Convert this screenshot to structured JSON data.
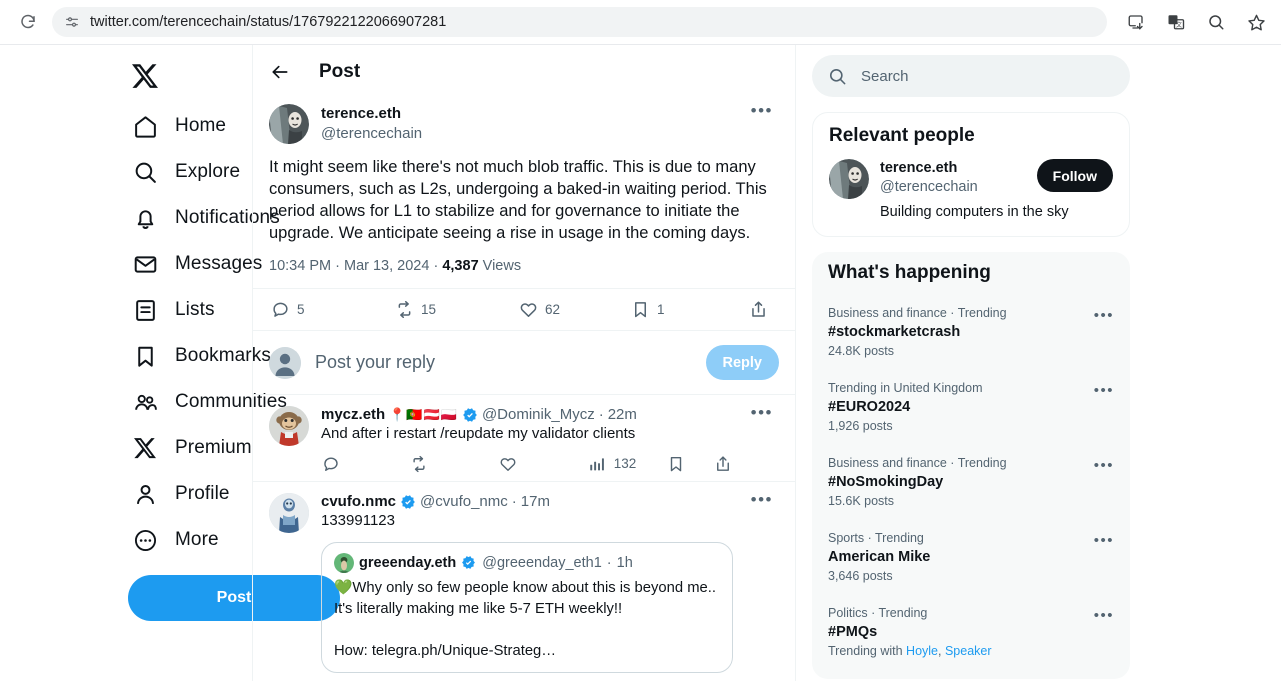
{
  "browser": {
    "url": "twitter.com/terencechain/status/1767922122066907281",
    "reload_icon": "reload-icon",
    "site_settings_icon": "site-settings-icon",
    "actions": [
      "install-app-icon",
      "translate-icon",
      "zoom-search-icon",
      "bookmark-star-icon"
    ]
  },
  "sidebar": {
    "logo": "x-logo",
    "items": [
      {
        "label": "Home",
        "icon": "home-icon"
      },
      {
        "label": "Explore",
        "icon": "search-icon"
      },
      {
        "label": "Notifications",
        "icon": "bell-icon"
      },
      {
        "label": "Messages",
        "icon": "envelope-icon"
      },
      {
        "label": "Lists",
        "icon": "list-icon"
      },
      {
        "label": "Bookmarks",
        "icon": "bookmark-icon"
      },
      {
        "label": "Communities",
        "icon": "communities-icon"
      },
      {
        "label": "Premium",
        "icon": "x-icon"
      },
      {
        "label": "Profile",
        "icon": "person-icon"
      },
      {
        "label": "More",
        "icon": "more-circle-icon"
      }
    ],
    "post_button": "Post"
  },
  "center": {
    "header_title": "Post",
    "back_icon": "back-arrow-icon",
    "post": {
      "display_name": "terence.eth",
      "handle": "@terencechain",
      "text": "It might seem like there's not much blob traffic. This is due to many consumers, such as L2s, undergoing a baked-in waiting period. This period allows for L1 to stabilize and for governance to initiate the upgrade. We anticipate seeing a rise in usage in the coming days.",
      "time": "10:34 PM",
      "date": "Mar 13, 2024",
      "views_count": "4,387",
      "views_label": "Views",
      "meta_separator": "·",
      "actions": {
        "reply": "5",
        "repost": "15",
        "like": "62",
        "bookmark": "1",
        "share": ""
      }
    },
    "composer": {
      "placeholder": "Post your reply",
      "button": "Reply"
    },
    "replies": [
      {
        "display_name": "mycz.eth",
        "emojis": "📍🇵🇹🇦🇹🇵🇱",
        "verified": true,
        "handle": "@Dominik_Mycz",
        "separator": "·",
        "timestamp": "22m",
        "text": "And after i restart /reupdate my validator clients",
        "actions": {
          "reply": "",
          "repost": "",
          "like": "",
          "views": "132"
        }
      },
      {
        "display_name": "cvufo.nmc",
        "verified": true,
        "handle": "@cvufo_nmc",
        "separator": "·",
        "timestamp": "17m",
        "text": "133991123",
        "quote": {
          "display_name": "greeenday.eth",
          "verified": true,
          "handle": "@greeenday_eth1",
          "separator": "·",
          "timestamp": "1h",
          "text": "💚Why only so few people know about this is beyond me.. It's literally making me like 5-7 ETH weekly!!\n\nHow: telegra.ph/Unique-Strateg…"
        }
      }
    ]
  },
  "right": {
    "search_placeholder": "Search",
    "search_icon": "search-icon",
    "relevant_people": {
      "title": "Relevant people",
      "person": {
        "display_name": "terence.eth",
        "handle": "@terencechain",
        "bio": "Building computers in the sky",
        "follow_label": "Follow"
      }
    },
    "whats_happening": {
      "title": "What's happening",
      "trends": [
        {
          "category": "Business and finance · Trending",
          "name": "#stockmarketcrash",
          "count": "24.8K posts"
        },
        {
          "category": "Trending in United Kingdom",
          "name": "#EURO2024",
          "count": "1,926 posts"
        },
        {
          "category": "Business and finance · Trending",
          "name": "#NoSmokingDay",
          "count": "15.6K posts"
        },
        {
          "category": "Sports · Trending",
          "name": "American Mike",
          "count": "3,646 posts"
        },
        {
          "category": "Politics · Trending",
          "name": "#PMQs",
          "count": "Trending with ",
          "links": [
            "Hoyle",
            "Speaker"
          ]
        }
      ]
    }
  },
  "colors": {
    "accent": "#1d9bf0",
    "text": "#0f1419",
    "muted": "#536471",
    "border": "#eff3f4",
    "verified": "#1d9bf0"
  }
}
